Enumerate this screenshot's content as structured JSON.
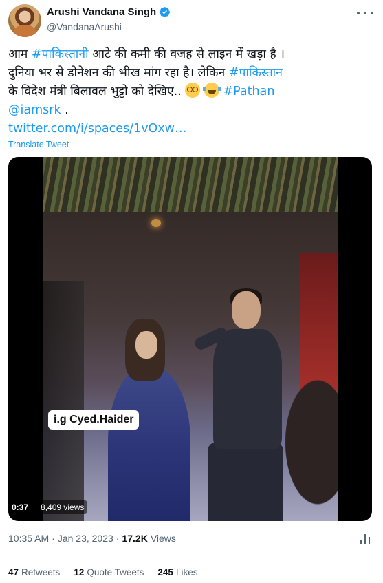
{
  "author": {
    "display_name": "Arushi Vandana Singh",
    "handle": "@VandanaArushi",
    "verified": true
  },
  "tweet": {
    "line1_a": "आम ",
    "line1_hashtag": "#पाकिस्तानी",
    "line1_b": " आटे की कमी की वजह से लाइन में खड़ा है ।",
    "line2_a": "दुनिया भर से डोनेशन की भीख मांग रहा है। लेकिन ",
    "line2_hashtag": "#पाकिस्तान",
    "line3_a": "के विदेश मंत्री बिलावल भुट्टो को देखिए.. ",
    "line3_hashtag": "#Pathan",
    "line4_mention": "@iamsrk",
    "line4_b": " .",
    "line5_link": "twitter.com/i/spaces/1vOxw…",
    "translate_label": "Translate Tweet"
  },
  "video": {
    "watermark": "i.g Cyed.Haider",
    "duration": "0:37",
    "views": "8,409 views"
  },
  "meta": {
    "time": "10:35 AM",
    "separator": "·",
    "date": "Jan 23, 2023",
    "separator2": "·",
    "views_count": "17.2K",
    "views_label": "Views"
  },
  "counts": {
    "retweets": "47",
    "retweets_label": "Retweets",
    "quotes": "12",
    "quotes_label": "Quote Tweets",
    "likes": "245",
    "likes_label": "Likes"
  },
  "colors": {
    "link": "#1d9bf0",
    "text": "#0f1419",
    "muted": "#536471",
    "verified": "#1d9bf0"
  },
  "icons": [
    "verified-badge-icon",
    "more-icon",
    "dizzy-face-emoji",
    "tears-of-joy-emoji",
    "analytics-icon"
  ]
}
